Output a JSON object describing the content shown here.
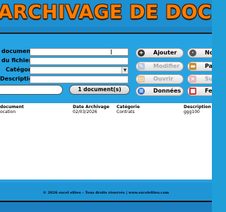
{
  "header": {
    "title": "ARCHIVAGE DE DOCUMENTS"
  },
  "form": {
    "fields": [
      {
        "label": "document",
        "value": ""
      },
      {
        "label": "du fichier",
        "value": ""
      },
      {
        "label": "Catégorie",
        "value": ""
      },
      {
        "label": "Description",
        "value": ""
      }
    ],
    "count_label": "1 document(s)"
  },
  "buttons": {
    "ajouter": "Ajouter",
    "nouveau": "Nou",
    "modifier": "Modifier",
    "parcourir": "Parc",
    "ouvrir": "Ouvrir",
    "supprimer": "Supp",
    "donnees": "Données",
    "fermer": "Fe"
  },
  "table": {
    "headers": [
      "document",
      "Date Archivage",
      "Catégorie",
      "Description"
    ],
    "rows": [
      [
        "ocation",
        "02/03/2026",
        "Contrats",
        "ggg100"
      ]
    ]
  },
  "footer": {
    "text": "© 2026 excel elites – Tous droits réservés | www.excelelites.com"
  },
  "colors": {
    "title": "#ff7d00",
    "background": "#1f9ed8",
    "accent_blue": "#2b6fcf",
    "accent_red": "#d42a2a"
  }
}
